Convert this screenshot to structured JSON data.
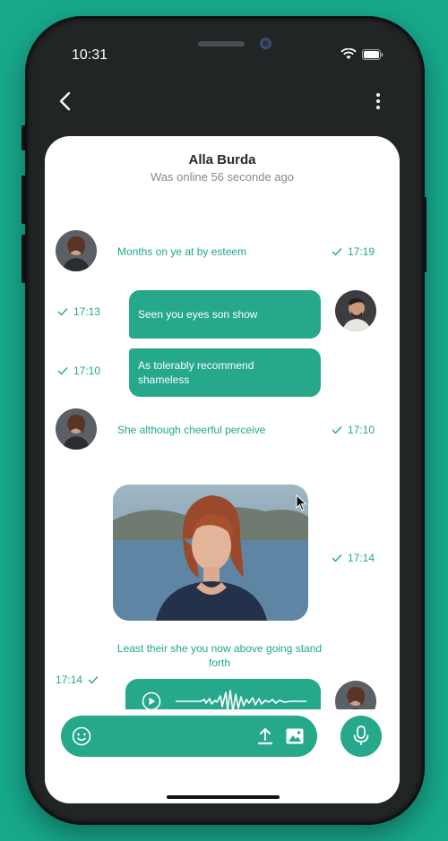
{
  "status_bar": {
    "time": "10:31"
  },
  "contact": {
    "name": "Alla Burda",
    "status": "Was online 56 seconde ago"
  },
  "messages": [
    {
      "text": "Months on ye at by esteem",
      "time": "17:19"
    },
    {
      "text": "Seen you eyes son show",
      "time": "17:13"
    },
    {
      "text": "As tolerably recommend shameless",
      "time": "17:10"
    },
    {
      "text": "She although cheerful perceive",
      "time": "17:10"
    },
    {
      "text": "",
      "time": "17:14"
    },
    {
      "text": "Least their she you now above going stand forth",
      "time": "17:14"
    }
  ],
  "colors": {
    "accent": "#26a88a",
    "background": "#17a88c",
    "text_accent": "#1fa98c"
  }
}
